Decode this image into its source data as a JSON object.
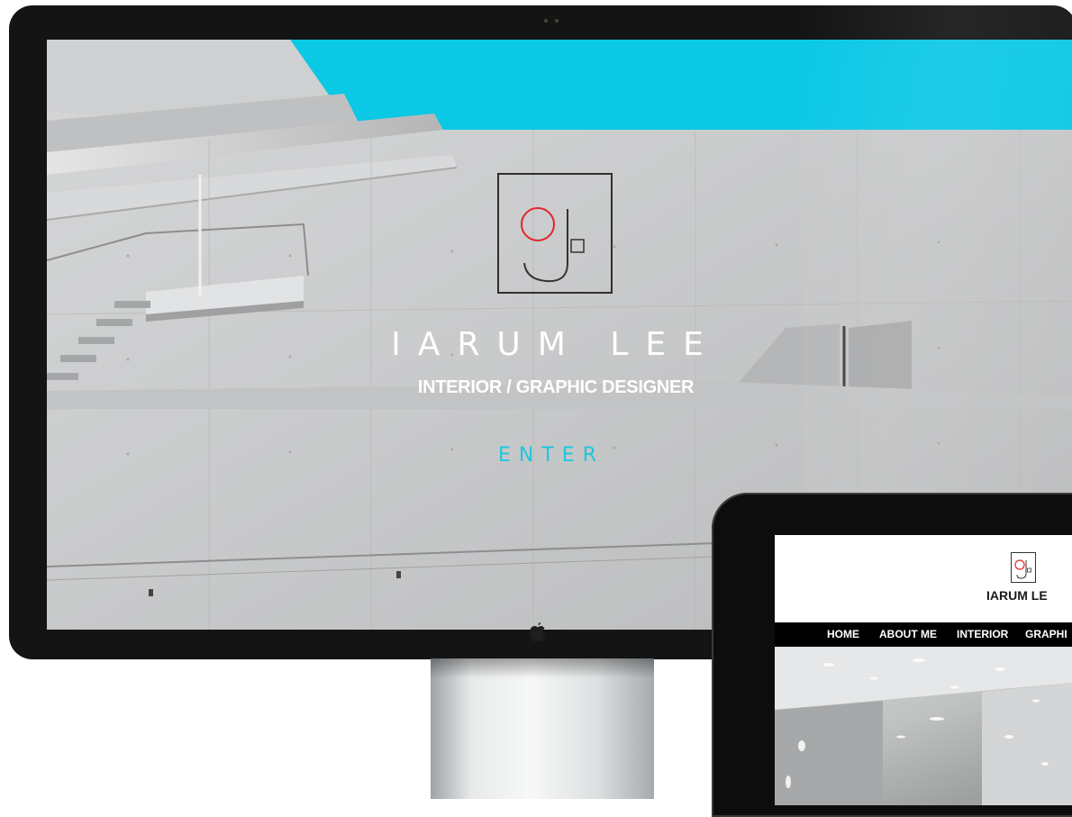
{
  "desktop": {
    "accent_color": "#1cc7e0",
    "logo_icon": "ij-monogram-logo",
    "hero_name": "IARUM LEE",
    "hero_subtitle": "INTERIOR / GRAPHIC DESIGNER",
    "enter_label": "ENTER"
  },
  "tablet": {
    "site_name": "IARUM LE",
    "nav": [
      "HOME",
      "ABOUT ME",
      "INTERIOR",
      "GRAPHI"
    ]
  }
}
